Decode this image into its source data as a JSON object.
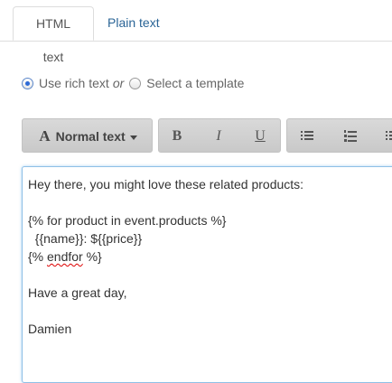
{
  "tabs": [
    {
      "label": "HTML text",
      "active": true
    },
    {
      "label": "Plain text",
      "active": false
    }
  ],
  "source_options": {
    "rich_text_label": "Use rich text",
    "or_text": "or",
    "template_label": "Select a template",
    "selected": "rich_text"
  },
  "toolbar": {
    "style_label": "Normal text",
    "style_icon_letter": "A",
    "bold_label": "B",
    "italic_label": "I",
    "underline_label": "U",
    "icons": [
      "bullet-list-icon",
      "numbered-list-icon",
      "more-icon"
    ]
  },
  "editor": {
    "lines": [
      "Hey there, you might love these related products:",
      "",
      "{% for product in event.products %}",
      "  {{name}}: ${{price}}",
      "{% ",
      "endfor",
      " %}",
      "",
      "Have a great day,",
      "",
      "Damien"
    ]
  },
  "colors": {
    "link": "#2a6496",
    "focus_border": "#8fc0e6",
    "spell_error": "#dd0000"
  }
}
